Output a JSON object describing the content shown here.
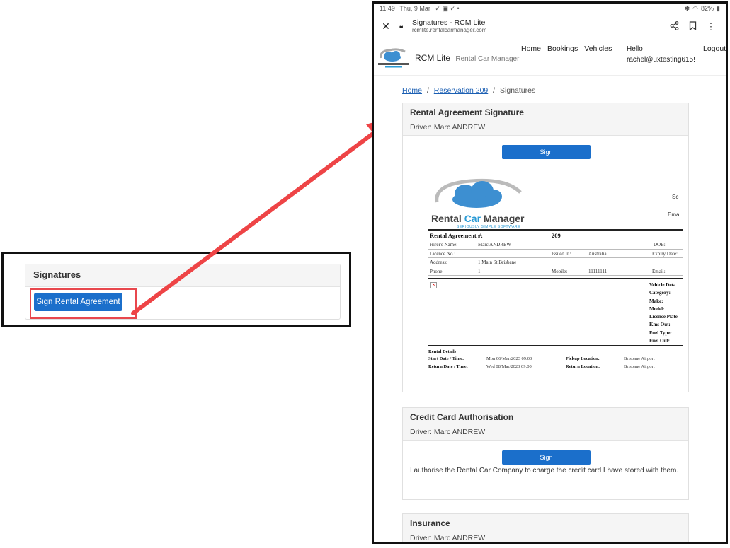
{
  "callout": {
    "panel_title": "Signatures",
    "button_label": "Sign Rental Agreement"
  },
  "tablet": {
    "status_time": "11:49",
    "status_date": "Thu, 9 Mar",
    "status_icons": "✓ ▣ ✓ •",
    "status_battery": "82%",
    "page_title": "Signatures - RCM Lite",
    "page_url": "rcmlite.rentalcarmanager.com",
    "brand": "RCM Lite",
    "brand_sub": "Rental Car Manager",
    "nav": [
      "Home",
      "Bookings",
      "Vehicles"
    ],
    "hello": "Hello",
    "user_email": "rachel@uxtesting615!",
    "logout": "Logout",
    "breadcrumb": {
      "home": "Home",
      "reservation": "Reservation 209",
      "current": "Signatures",
      "separator": "/"
    },
    "cards": [
      {
        "title": "Rental Agreement Signature",
        "driver": "Driver: Marc ANDREW",
        "button": "Sign"
      },
      {
        "title": "Credit Card Authorisation",
        "driver": "Driver: Marc ANDREW",
        "button": "Sign",
        "text": "I authorise the Rental Car Company to charge the credit card I have stored with them."
      },
      {
        "title": "Insurance",
        "driver": "Driver: Marc ANDREW"
      }
    ],
    "document": {
      "logo_text_1": "Rental ",
      "logo_text_2": "Car",
      "logo_text_3": " Manager",
      "logo_tagline": "SERIOUSLY SIMPLE SOFTWARE",
      "sc": "Sc",
      "ema": "Ema",
      "agreement_label": "Rental Agreement #:",
      "agreement_no": "209",
      "dob_label": "DOB:",
      "hirer_label": "Hirer's Name:",
      "hirer": "Marc ANDREW",
      "licence_label": "Licence No.:",
      "issued_label": "Issued In:",
      "issued": "Australia",
      "expiry_label": "Expiry Date:",
      "address_label": "Address:",
      "address": "1 Main St  Brisbane",
      "phone_label": "Phone:",
      "phone": "1",
      "mobile_label": "Mobile:",
      "mobile": "11111111",
      "email_label": "Email:",
      "vehicle_labels": [
        "Vehicle Deta",
        "Category:",
        "Make:",
        "Model:",
        "Licence Plate",
        "Kms Out:",
        "Fuel Type:",
        "Fuel Out:"
      ],
      "rental_details": "Rental Details",
      "start_label": "Start Date / Time:",
      "start": "Mon 06/Mar/2023 09:00",
      "pickup_label": "Pickup Location:",
      "pickup": "Brisbane Airport",
      "return_label": "Return Date / Time:",
      "return": "Wed 08/Mar/2023 09:00",
      "return_loc_label": "Return Location:",
      "return_loc": "Brisbane Airport"
    }
  }
}
